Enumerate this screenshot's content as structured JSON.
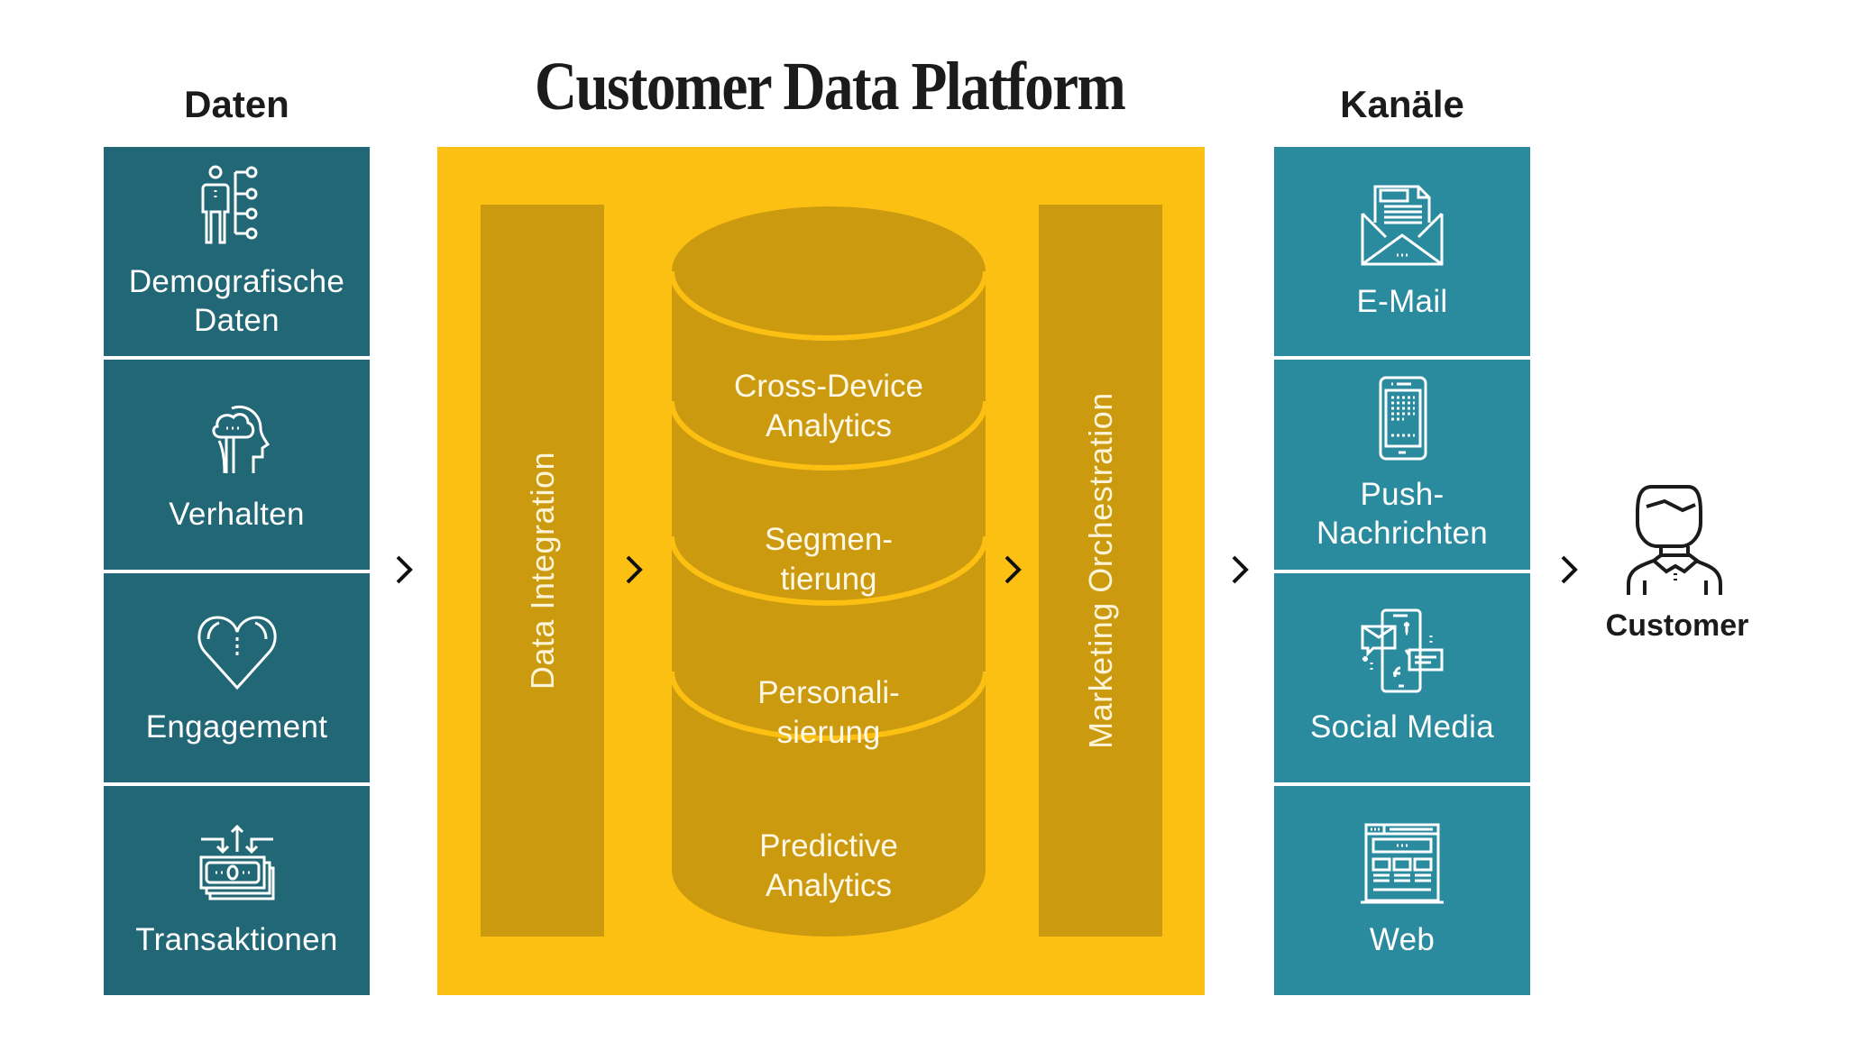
{
  "title": "Customer Data Platform",
  "colors": {
    "data_tile": "#216776",
    "channel_tile": "#2a8a9e",
    "platform_bg": "#fcc013",
    "platform_inner": "#cb9a0f",
    "text_dark": "#1b1b1b"
  },
  "data_sources": {
    "heading": "Daten",
    "items": [
      {
        "label": "Demografische\nDaten",
        "icon": "demographics-icon"
      },
      {
        "label": "Verhalten",
        "icon": "head-cloud-icon"
      },
      {
        "label": "Engagement",
        "icon": "heart-icon"
      },
      {
        "label": "Transaktionen",
        "icon": "money-transfer-icon"
      }
    ]
  },
  "platform": {
    "integration_label": "Data Integration",
    "orchestration_label": "Marketing Orchestration",
    "database_layers": [
      {
        "line1": "Cross-Device",
        "line2": "Analytics"
      },
      {
        "line1": "Segmen-",
        "line2": "tierung"
      },
      {
        "line1": "Personali-",
        "line2": "sierung"
      },
      {
        "line1": "Predictive",
        "line2": "Analytics"
      }
    ]
  },
  "channels": {
    "heading": "Kanäle",
    "items": [
      {
        "label": "E-Mail",
        "icon": "email-icon"
      },
      {
        "label": "Push-\nNachrichten",
        "icon": "smartphone-icon"
      },
      {
        "label": "Social Media",
        "icon": "social-media-icon"
      },
      {
        "label": "Web",
        "icon": "web-page-icon"
      }
    ]
  },
  "customer": {
    "label": "Customer",
    "icon": "customer-icon"
  },
  "flow_arrows": [
    "chevron-right-icon",
    "chevron-right-icon",
    "chevron-right-icon",
    "chevron-right-icon",
    "chevron-right-icon"
  ]
}
